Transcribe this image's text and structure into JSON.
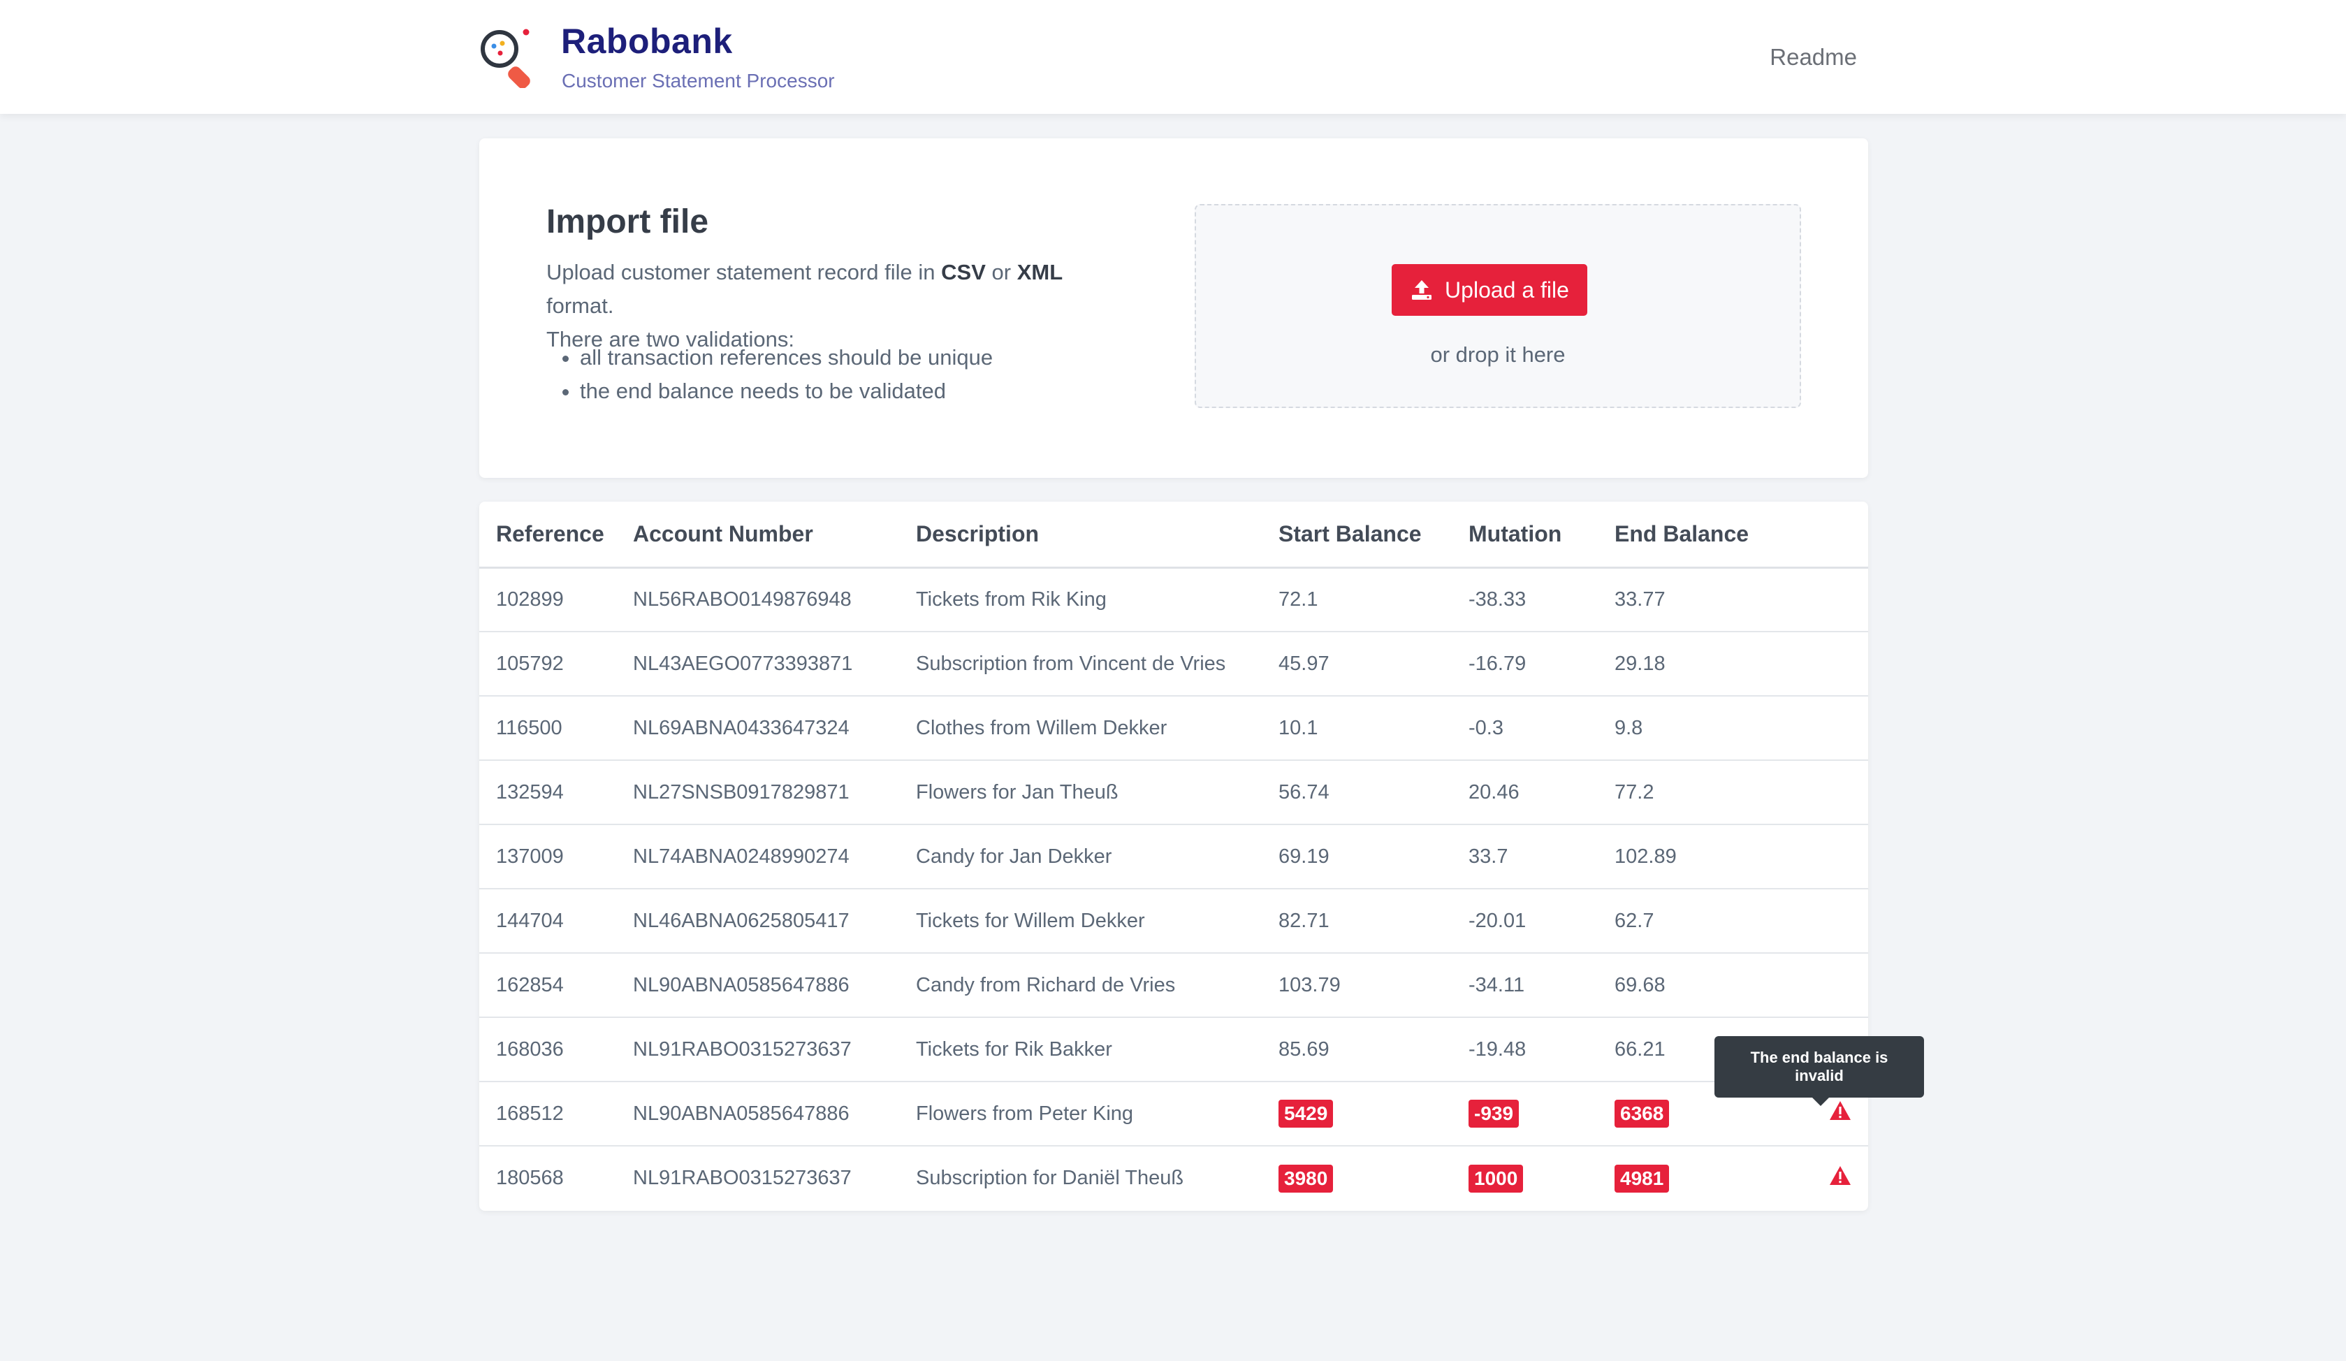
{
  "header": {
    "brand_title": "Rabobank",
    "brand_subtitle": "Customer Statement Processor",
    "nav_readme": "Readme",
    "logo_icon": "magnifier-logo-icon"
  },
  "import": {
    "title": "Import file",
    "desc_prefix": "Upload customer statement record file in ",
    "desc_csv": "CSV",
    "desc_or": " or ",
    "desc_xml": "XML",
    "desc_suffix": " format.",
    "desc_line2": "There are two validations:",
    "validations": [
      "all transaction references should be unique",
      "the end balance needs to be validated"
    ],
    "upload_button": "Upload a file",
    "upload_icon": "upload-icon",
    "drop_text": "or drop it here"
  },
  "table": {
    "headers": [
      "Reference",
      "Account Number",
      "Description",
      "Start Balance",
      "Mutation",
      "End Balance"
    ],
    "rows": [
      {
        "reference": "102899",
        "account": "NL56RABO0149876948",
        "description": "Tickets from Rik King",
        "start": "72.1",
        "mutation": "-38.33",
        "end": "33.77",
        "invalid": false
      },
      {
        "reference": "105792",
        "account": "NL43AEGO0773393871",
        "description": "Subscription from Vincent de Vries",
        "start": "45.97",
        "mutation": "-16.79",
        "end": "29.18",
        "invalid": false
      },
      {
        "reference": "116500",
        "account": "NL69ABNA0433647324",
        "description": "Clothes from Willem Dekker",
        "start": "10.1",
        "mutation": "-0.3",
        "end": "9.8",
        "invalid": false
      },
      {
        "reference": "132594",
        "account": "NL27SNSB0917829871",
        "description": "Flowers for Jan Theuß",
        "start": "56.74",
        "mutation": "20.46",
        "end": "77.2",
        "invalid": false
      },
      {
        "reference": "137009",
        "account": "NL74ABNA0248990274",
        "description": "Candy for Jan Dekker",
        "start": "69.19",
        "mutation": "33.7",
        "end": "102.89",
        "invalid": false
      },
      {
        "reference": "144704",
        "account": "NL46ABNA0625805417",
        "description": "Tickets for Willem Dekker",
        "start": "82.71",
        "mutation": "-20.01",
        "end": "62.7",
        "invalid": false
      },
      {
        "reference": "162854",
        "account": "NL90ABNA0585647886",
        "description": "Candy from Richard de Vries",
        "start": "103.79",
        "mutation": "-34.11",
        "end": "69.68",
        "invalid": false
      },
      {
        "reference": "168036",
        "account": "NL91RABO0315273637",
        "description": "Tickets for Rik Bakker",
        "start": "85.69",
        "mutation": "-19.48",
        "end": "66.21",
        "invalid": false
      },
      {
        "reference": "168512",
        "account": "NL90ABNA0585647886",
        "description": "Flowers from Peter King",
        "start": "5429",
        "mutation": "-939",
        "end": "6368",
        "invalid": true
      },
      {
        "reference": "180568",
        "account": "NL91RABO0315273637",
        "description": "Subscription for Daniël Theuß",
        "start": "3980",
        "mutation": "1000",
        "end": "4981",
        "invalid": true
      }
    ],
    "warning_icon": "warning-triangle-icon"
  },
  "tooltip": {
    "text": "The end balance is invalid"
  },
  "colors": {
    "accent_red": "#e6213b",
    "brand_navy": "#1d1f7a",
    "brand_subtitle": "#6a6fb4",
    "tooltip_bg": "#353c43"
  }
}
